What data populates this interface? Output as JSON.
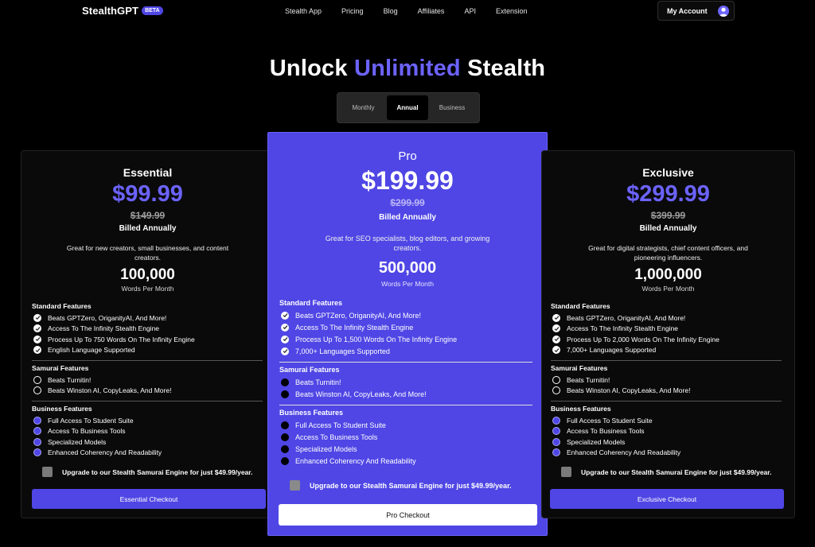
{
  "nav": {
    "brand": "StealthGPT",
    "beta": "BETA",
    "links": [
      "Stealth App",
      "Pricing",
      "Blog",
      "Affiliates",
      "API",
      "Extension"
    ],
    "account": "My Account"
  },
  "header": {
    "title_pre": "Unlock",
    "title_accent": "Unlimited",
    "title_post": "Stealth",
    "toggle": [
      "Monthly",
      "Annual",
      "Business"
    ],
    "toggle_selected": "Annual"
  },
  "colors": {
    "accent": "#6c63ff",
    "brand": "#4f46e5",
    "background": "#000000"
  },
  "section_titles": {
    "standard": "Standard Features",
    "samurai": "Samurai Features",
    "business": "Business Features"
  },
  "plans": [
    {
      "name": "Essential",
      "price": "$99.99",
      "old_price": "$149.99",
      "billed": "Billed Annually",
      "desc": "Great for new creators, small businesses, and content creators.",
      "words": "100,000",
      "words_sub": "Words Per Month",
      "standard": [
        "Beats GPTZero, OriganityAI, And More!",
        "Access To The Infinity Stealth Engine",
        "Process Up To 750 Words On The Infinity Engine",
        "English Language Supported"
      ],
      "samurai": [
        "Beats Turnitin!",
        "Beats Winston AI, CopyLeaks, And More!"
      ],
      "business": [
        "Full Access To Student Suite",
        "Access To Business Tools",
        "Specialized Models",
        "Enhanced Coherency And Readability"
      ],
      "upsell": "Upgrade to our Stealth Samurai Engine for just $49.99/year.",
      "checkout": "Essential Checkout"
    },
    {
      "name": "Pro",
      "price": "$199.99",
      "old_price": "$299.99",
      "billed": "Billed Annually",
      "desc": "Great for SEO specialists, blog editors, and growing creators.",
      "words": "500,000",
      "words_sub": "Words Per Month",
      "standard": [
        "Beats GPTZero, OriganityAI, And More!",
        "Access To The Infinity Stealth Engine",
        "Process Up To 1,500 Words On The Infinity Engine",
        "7,000+ Languages Supported"
      ],
      "samurai": [
        "Beats Turnitin!",
        "Beats Winston AI, CopyLeaks, And More!"
      ],
      "business": [
        "Full Access To Student Suite",
        "Access To Business Tools",
        "Specialized Models",
        "Enhanced Coherency And Readability"
      ],
      "upsell": "Upgrade to our Stealth Samurai Engine for just $49.99/year.",
      "checkout": "Pro Checkout"
    },
    {
      "name": "Exclusive",
      "price": "$299.99",
      "old_price": "$399.99",
      "billed": "Billed Annually",
      "desc": "Great for digital strategists, chief content officers, and pioneering influencers.",
      "words": "1,000,000",
      "words_sub": "Words Per Month",
      "standard": [
        "Beats GPTZero, OriganityAI, And More!",
        "Access To The Infinity Stealth Engine",
        "Process Up To 2,000 Words On The Infinity Engine",
        "7,000+ Languages Supported"
      ],
      "samurai": [
        "Beats Turnitin!",
        "Beats Winston AI, CopyLeaks, And More!"
      ],
      "business": [
        "Full Access To Student Suite",
        "Access To Business Tools",
        "Specialized Models",
        "Enhanced Coherency And Readability"
      ],
      "upsell": "Upgrade to our Stealth Samurai Engine for just $49.99/year.",
      "checkout": "Exclusive Checkout"
    }
  ]
}
